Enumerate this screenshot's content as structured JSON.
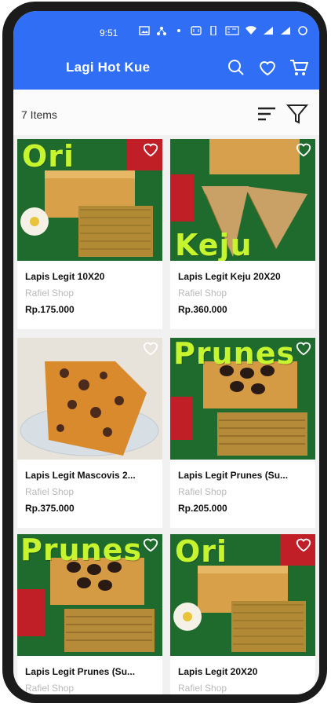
{
  "status_bar": {
    "time": "9:51",
    "icons": [
      "gallery-icon",
      "network-icon",
      "dot-icon",
      "nfc-icon",
      "vibrate-icon",
      "volte-icon",
      "wifi-icon",
      "signal-icon",
      "signal-icon",
      "sync-icon"
    ]
  },
  "appbar": {
    "title": "Lagi Hot Kue",
    "color": "#2f6ef5",
    "actions": [
      "search-icon",
      "heart-icon",
      "cart-icon"
    ]
  },
  "toolbar": {
    "items_count": "7 Items",
    "sort_icon": "sort-icon",
    "filter_icon": "filter-icon"
  },
  "products": [
    {
      "name": "Lapis Legit  10X20",
      "shop": "Rafiel Shop",
      "price": "Rp.175.000",
      "label": "Ori"
    },
    {
      "name": "Lapis Legit  Keju 20X20",
      "shop": "Rafiel Shop",
      "price": "Rp.360.000",
      "label": "Keju"
    },
    {
      "name": "Lapis Legit  Mascovis 2...",
      "shop": "Rafiel Shop",
      "price": "Rp.375.000",
      "label": ""
    },
    {
      "name": "Lapis Legit  Prunes (Su...",
      "shop": "Rafiel Shop",
      "price": "Rp.205.000",
      "label": "Prunes"
    },
    {
      "name": "Lapis Legit  Prunes (Su...",
      "shop": "Rafiel Shop",
      "price": "",
      "label": "Prunes"
    },
    {
      "name": "Lapis Legit 20X20",
      "shop": "Rafiel Shop",
      "price": "",
      "label": "Ori"
    }
  ]
}
